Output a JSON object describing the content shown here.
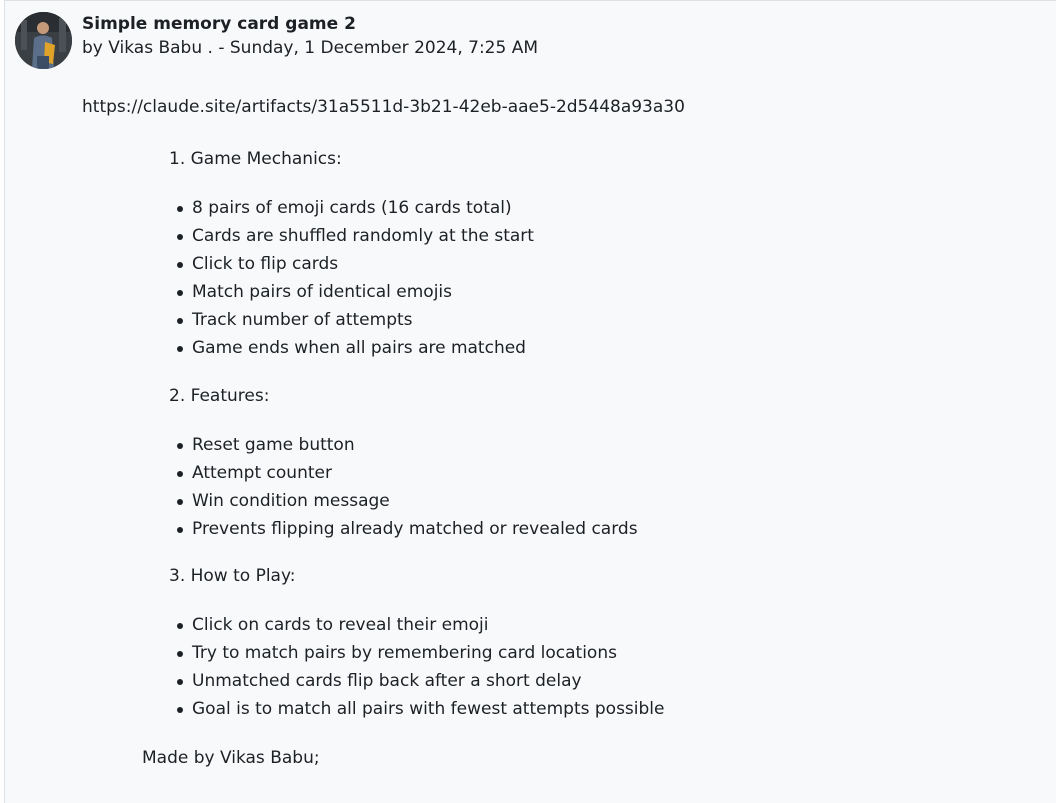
{
  "post": {
    "subject": "Simple memory card game 2",
    "byline_prefix": "by ",
    "author": "Vikas Babu .",
    "byline_separator": " - ",
    "date": "Sunday, 1 December 2024, 7:25 AM",
    "link": "https://claude.site/artifacts/31a5511d-3b21-42eb-aae5-2d5448a93a30"
  },
  "sections": [
    {
      "title": "1. Game Mechanics:",
      "items": [
        "8 pairs of emoji cards (16 cards total)",
        "Cards are shuffled randomly at the start",
        "Click to flip cards",
        "Match pairs of identical emojis",
        "Track number of attempts",
        "Game ends when all pairs are matched"
      ]
    },
    {
      "title": "2. Features:",
      "items": [
        "Reset game button",
        "Attempt counter",
        "Win condition message",
        "Prevents flipping already matched or revealed cards"
      ]
    },
    {
      "title": "3. How to Play:",
      "items": [
        "Click on cards to reveal their emoji",
        "Try to match pairs by remembering card locations",
        "Unmatched cards flip back after a short delay",
        "Goal is to match all pairs with fewest attempts possible"
      ]
    }
  ],
  "footer": "Made by Vikas Babu;",
  "icons": {
    "avatar": "user-avatar-photo"
  },
  "colors": {
    "text": "#1d2125",
    "background": "#f8f9fa",
    "border": "#dee2e6"
  }
}
